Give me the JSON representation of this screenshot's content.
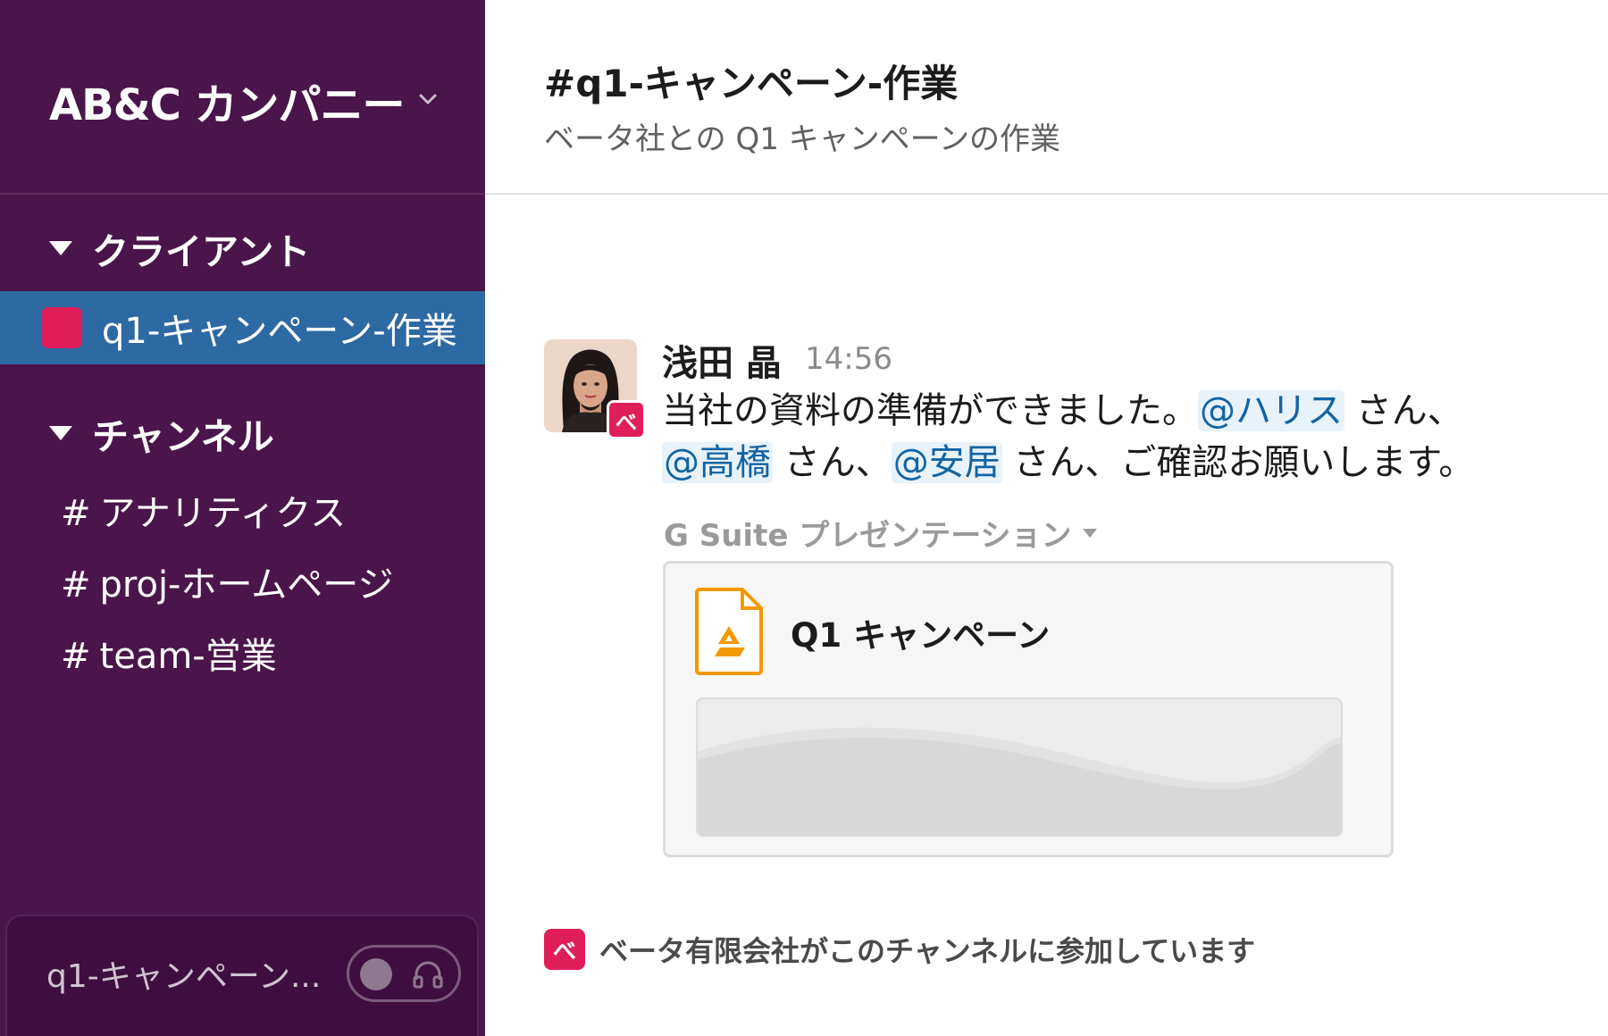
{
  "workspace": {
    "name": "AB&C カンパニー"
  },
  "sidebar": {
    "sections": [
      {
        "title": "クライアント",
        "items": [
          {
            "label": "q1-キャンペーン-作業",
            "active": true
          }
        ]
      },
      {
        "title": "チャンネル",
        "items": [
          {
            "prefix": "#",
            "label": "アナリティクス"
          },
          {
            "prefix": "#",
            "label": "proj-ホームページ"
          },
          {
            "prefix": "#",
            "label": "team-営業"
          }
        ]
      }
    ],
    "footer": {
      "text": "q1-キャンペーン..."
    }
  },
  "channel": {
    "title": "#q1-キャンペーン-作業",
    "topic": "ベータ社との Q1 キャンペーンの作業"
  },
  "message": {
    "author": "浅田 晶",
    "time": "14:56",
    "org_badge": "べ",
    "line1_text": "当社の資料の準備ができました。",
    "mention1": "@ハリス",
    "line1_after": " さん、",
    "mention2": "@高橋",
    "line2_mid": " さん、",
    "mention3": "@安居",
    "line2_after": " さん、ご確認お願いします。",
    "attachment": {
      "source": "G Suite プレゼンテーション",
      "title": "Q1 キャンペーン"
    }
  },
  "notice": {
    "badge": "べ",
    "text": "ベータ有限会社がこのチャンネルに参加しています"
  },
  "colors": {
    "sidebar": "#4a154b",
    "active": "#2d69a3",
    "accent": "#e01e5a",
    "mention": "#1264a3",
    "slides_orange": "#f29900"
  },
  "icons": [
    "chevron-down-icon",
    "collapse-triangle-icon",
    "channel-hash-icon",
    "headphones-icon",
    "slides-file-icon",
    "dropdown-caret-icon"
  ]
}
